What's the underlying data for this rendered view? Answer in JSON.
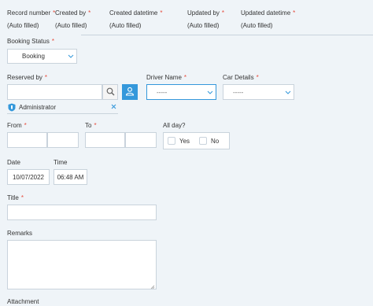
{
  "header": {
    "record_number": {
      "label": "Record number",
      "value": "(Auto filled)"
    },
    "created_by": {
      "label": "Created by",
      "value": "(Auto filled)"
    },
    "created_datetime": {
      "label": "Created datetime",
      "value": "(Auto filled)"
    },
    "updated_by": {
      "label": "Updated by",
      "value": "(Auto filled)"
    },
    "updated_datetime": {
      "label": "Updated datetime",
      "value": "(Auto filled)"
    }
  },
  "required_mark": "*",
  "booking_status": {
    "label": "Booking Status",
    "value": "Booking"
  },
  "reserved_by": {
    "label": "Reserved by",
    "value": "",
    "selected_user": "Administrator"
  },
  "driver_name": {
    "label": "Driver Name",
    "value": "-----"
  },
  "car_details": {
    "label": "Car Details",
    "value": "-----"
  },
  "from": {
    "label": "From",
    "date": "",
    "time": ""
  },
  "to": {
    "label": "To",
    "date": "",
    "time": ""
  },
  "all_day": {
    "label": "All day?",
    "options": [
      "Yes",
      "No"
    ]
  },
  "date": {
    "label": "Date",
    "value": "10/07/2022"
  },
  "time": {
    "label": "Time",
    "value": "06:48 AM"
  },
  "title": {
    "label": "Title",
    "value": ""
  },
  "remarks": {
    "label": "Remarks",
    "value": ""
  },
  "attachment": {
    "label": "Attachment"
  },
  "colors": {
    "background": "#eff4f8",
    "border": "#c9d3dc",
    "accent": "#3498db",
    "required": "#e74c3c"
  }
}
